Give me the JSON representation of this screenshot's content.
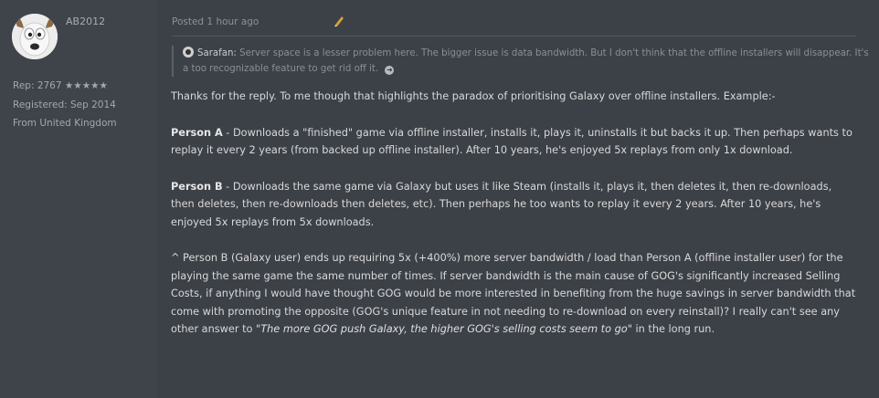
{
  "user": {
    "name": "AB2012",
    "rep": "Rep: 2767 ★★★★★",
    "registered": "Registered: Sep 2014",
    "location": "From United Kingdom"
  },
  "post": {
    "posted": "Posted 1 hour ago",
    "quote": {
      "author": "Sarafan:",
      "text": "Server space is a lesser problem here. The bigger issue is data bandwidth. But I don't think that the offline installers will disappear. It's a too recognizable feature to get rid off it."
    },
    "intro": "Thanks for the reply. To me though that highlights the paradox of prioritising Galaxy over offline installers. Example:-",
    "person_a_label": "Person A",
    "person_a_text": " - Downloads a \"finished\" game via offline installer, installs it, plays it, uninstalls it but backs it up. Then perhaps wants to replay it every 2 years (from backed up offline installer). After 10 years, he's enjoyed 5x replays from only 1x download.",
    "person_b_label": "Person B",
    "person_b_text": " - Downloads the same game via Galaxy but uses it like Steam (installs it, plays it, then deletes it, then re-downloads, then deletes, then re-downloads then deletes, etc). Then perhaps he too wants to replay it every 2 years. After 10 years, he's enjoyed 5x replays from 5x downloads.",
    "conclusion_text": "^ Person B (Galaxy user) ends up requiring 5x (+400%) more server bandwidth / load than Person A (offline installer user) for the playing the same game the same number of times. If server bandwidth is the main cause of GOG's significantly increased Selling Costs, if anything I would have thought GOG would be more interested in benefiting from the huge savings in server bandwidth that come with promoting the opposite (GOG's unique feature in not needing to re-download on every reinstall)? I really can't see any other answer to ",
    "conclusion_quote": "\"The more GOG push Galaxy, the higher GOG's selling costs seem to go\"",
    "conclusion_end": " in the long run."
  },
  "icons": {
    "edit": "pencil-icon",
    "quote_link": "arrow-right-circle-icon",
    "avatar": "user-avatar-icon"
  }
}
